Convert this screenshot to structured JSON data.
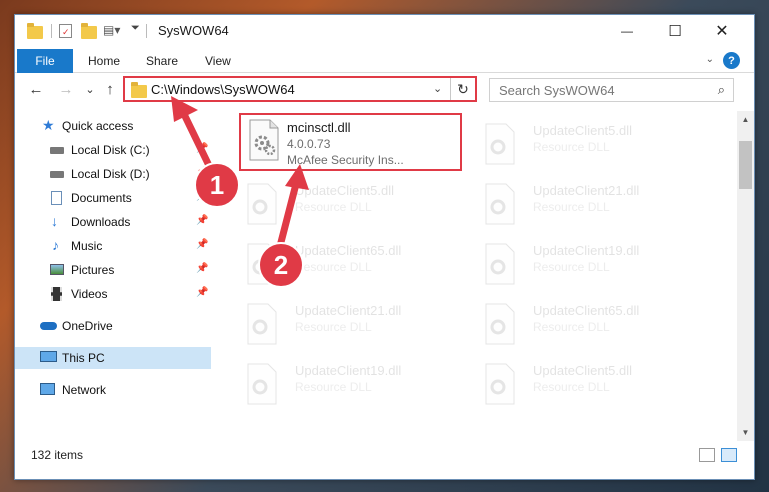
{
  "window": {
    "title": "SysWOW64",
    "minimize_glyph": "—",
    "maximize_glyph": "☐",
    "close_glyph": "✕"
  },
  "ribbon": {
    "tabs": [
      "File",
      "Home",
      "Share",
      "View"
    ],
    "help_glyph": "?"
  },
  "navbar": {
    "back_glyph": "←",
    "forward_glyph": "→",
    "recent_glyph": "⌄",
    "up_glyph": "↑",
    "address": "C:\\Windows\\SysWOW64",
    "address_dropdown_glyph": "⌄",
    "refresh_glyph": "↻",
    "search_placeholder": "Search SysWOW64"
  },
  "sidebar": {
    "items": [
      {
        "label": "Quick access",
        "icon": "star-icon",
        "color": "#2e7bd6"
      },
      {
        "label": "Local Disk (C:)",
        "icon": "drive-icon",
        "pinned": true
      },
      {
        "label": "Local Disk (D:)",
        "icon": "drive-icon",
        "pinned": true
      },
      {
        "label": "Documents",
        "icon": "documents-icon",
        "pinned": true
      },
      {
        "label": "Downloads",
        "icon": "download-icon",
        "pinned": true
      },
      {
        "label": "Music",
        "icon": "music-icon",
        "pinned": true
      },
      {
        "label": "Pictures",
        "icon": "pictures-icon",
        "pinned": true
      },
      {
        "label": "Videos",
        "icon": "videos-icon",
        "pinned": true
      },
      {
        "label": "OneDrive",
        "icon": "cloud-icon",
        "color": "#1d6fc2"
      },
      {
        "label": "This PC",
        "icon": "computer-icon",
        "selected": true
      },
      {
        "label": "Network",
        "icon": "network-icon"
      }
    ]
  },
  "files": {
    "left": [
      {
        "name": "mcinsctl.dll",
        "line1": "4.0.0.73",
        "line2": "McAfee Security Ins...",
        "highlighted": true
      },
      {
        "name": "UpdateClient5.dll",
        "line1": "Resource DLL"
      },
      {
        "name": "UpdateClient65.dll",
        "line1": "Resource DLL"
      },
      {
        "name": "UpdateClient21.dll",
        "line1": "Resource DLL"
      },
      {
        "name": "UpdateClient19.dll",
        "line1": "Resource DLL"
      }
    ],
    "right": [
      {
        "name": "UpdateClient5.dll",
        "line1": "Resource DLL"
      },
      {
        "name": "UpdateClient21.dll",
        "line1": "Resource DLL"
      },
      {
        "name": "UpdateClient19.dll",
        "line1": "Resource DLL"
      },
      {
        "name": "UpdateClient65.dll",
        "line1": "Resource DLL"
      },
      {
        "name": "UpdateClient5.dll",
        "line1": "Resource DLL"
      }
    ]
  },
  "status": {
    "item_count": "132 items"
  },
  "annotations": {
    "marker_1": "1",
    "marker_2": "2",
    "accent": "#e03a46"
  }
}
